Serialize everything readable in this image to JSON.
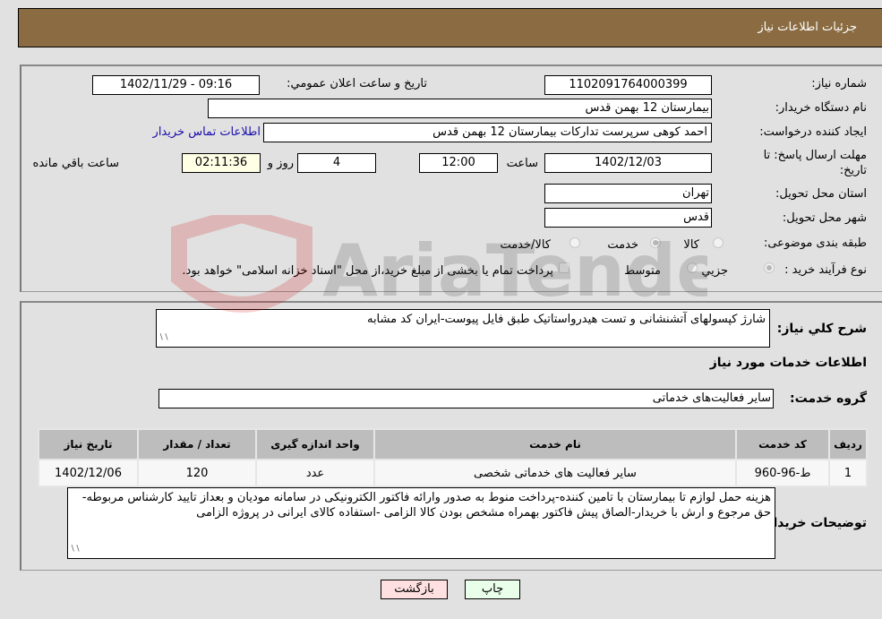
{
  "header": {
    "title": "جزئیات اطلاعات نیاز"
  },
  "form": {
    "need_number": {
      "label": "شماره نیاز:",
      "value": "1102091764000399"
    },
    "announce": {
      "label": "تاریخ و ساعت اعلان عمومي:",
      "value": "1402/11/29 - 09:16"
    },
    "buyer_org": {
      "label": "نام دستگاه خریدار:",
      "value": "بیمارستان 12 بهمن قدس"
    },
    "requester": {
      "label": "ایجاد کننده درخواست:",
      "value": "احمد کوهی سرپرست تدارکات بیمارستان 12 بهمن قدس",
      "contact_link": "اطلاعات تماس خریدار"
    },
    "deadline": {
      "label": "مهلت ارسال پاسخ: تا تاریخ:",
      "date": "1402/12/03",
      "time_label": "ساعت",
      "time": "12:00",
      "days": "4",
      "days_label": "روز و",
      "remaining": "02:11:36",
      "remaining_label": "ساعت باقي مانده"
    },
    "province": {
      "label": "استان محل تحویل:",
      "value": "تهران"
    },
    "city": {
      "label": "شهر محل تحویل:",
      "value": "قدس"
    },
    "category": {
      "label": "طبقه بندی موضوعی:",
      "options": [
        {
          "label": "کالا",
          "selected": false
        },
        {
          "label": "خدمت",
          "selected": true
        },
        {
          "label": "کالا/خدمت",
          "selected": false
        }
      ]
    },
    "purchase_type": {
      "label": "نوع فرآیند خرید :",
      "options": [
        {
          "label": "جزيي",
          "selected": true
        },
        {
          "label": "متوسط",
          "selected": false
        }
      ],
      "treasury_checkbox_label": "پرداخت تمام یا بخشی از مبلغ خرید،از محل \"اسناد خزانه اسلامی\" خواهد بود.",
      "treasury_checked": false
    }
  },
  "details": {
    "description_label": "شرح کلي نیاز:",
    "description": "شارژ کپسولهای آتشنشانی و تست هیدرواستاتیک طبق فایل پیوست-ایران کد مشابه",
    "services_heading": "اطلاعات خدمات مورد نیاز",
    "service_group_label": "گروه خدمت:",
    "service_group": "سایر فعالیت‌های خدماتی",
    "table": {
      "headers": [
        "ردیف",
        "کد خدمت",
        "نام خدمت",
        "واحد اندازه گیری",
        "تعداد / مقدار",
        "تاریخ نیاز"
      ],
      "rows": [
        [
          "1",
          "ط-96-960",
          "سایر فعالیت های خدماتی شخصی",
          "عدد",
          "120",
          "1402/12/06"
        ]
      ]
    },
    "buyer_notes_label": "توضیحات خریدار:",
    "buyer_notes": "هزینه حمل لوازم تا بیمارستان با تامین کننده-پرداخت منوط به صدور وارائه فاکتور الکترونیکی  در سامانه مودیان و  بعداز تایید کارشناس مربوطه-حق مرجوع و ارش با خریدار-الصاق پیش فاکتور بهمراه مشخص بودن کالا الزامی -استفاده کالای ایرانی در پروژه الزامی"
  },
  "buttons": {
    "print": "چاپ",
    "back": "بازگشت"
  },
  "watermark": "AriaTender.neT",
  "colors": {
    "header_bg": "#8b6c42",
    "print_bg": "#eaffea",
    "back_bg": "#ffe0e0",
    "link": "#1a0dab"
  }
}
